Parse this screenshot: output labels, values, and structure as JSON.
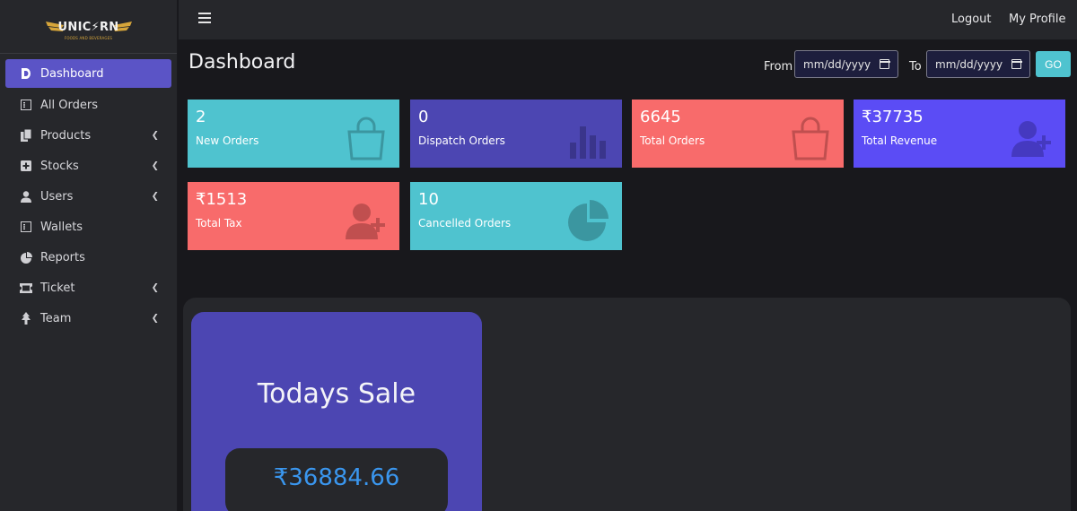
{
  "brand": {
    "logo_text": "UNIC⚡RN",
    "logo_sub": "FOODS AND BEVERAGES"
  },
  "sidebar": {
    "items": [
      {
        "label": "Dashboard",
        "icon": "dashboard-icon",
        "active": true,
        "has_submenu": false
      },
      {
        "label": "All Orders",
        "icon": "list-icon",
        "active": false,
        "has_submenu": false
      },
      {
        "label": "Products",
        "icon": "copy-icon",
        "active": false,
        "has_submenu": true
      },
      {
        "label": "Stocks",
        "icon": "plus-square-icon",
        "active": false,
        "has_submenu": true
      },
      {
        "label": "Users",
        "icon": "user-icon",
        "active": false,
        "has_submenu": true
      },
      {
        "label": "Wallets",
        "icon": "list-icon",
        "active": false,
        "has_submenu": false
      },
      {
        "label": "Reports",
        "icon": "pie-chart-icon",
        "active": false,
        "has_submenu": false
      },
      {
        "label": "Ticket",
        "icon": "ticket-icon",
        "active": false,
        "has_submenu": true
      },
      {
        "label": "Team",
        "icon": "tree-icon",
        "active": false,
        "has_submenu": true
      }
    ]
  },
  "topbar": {
    "logout": "Logout",
    "profile": "My Profile"
  },
  "main": {
    "title": "Dashboard",
    "from_label": "From",
    "to_label": "To",
    "from_placeholder": "mm/dd/yyyy",
    "to_placeholder": "mm/dd/yyyy",
    "go_label": "GO"
  },
  "cards": [
    {
      "value": "2",
      "label": "New Orders",
      "color": "#4fc3cf",
      "icon": "shopping-bag-icon"
    },
    {
      "value": "0",
      "label": "Dispatch Orders",
      "color": "#4c46b2",
      "icon": "bar-chart-icon"
    },
    {
      "value": "6645",
      "label": "Total Orders",
      "color": "#f86b6b",
      "icon": "shopping-bag-icon"
    },
    {
      "value": "₹37735",
      "label": "Total Revenue",
      "color": "#5b4cf5",
      "icon": "user-plus-icon"
    },
    {
      "value": "₹1513",
      "label": "Total Tax",
      "color": "#f86b6b",
      "icon": "user-plus-icon"
    },
    {
      "value": "10",
      "label": "Cancelled Orders",
      "color": "#4fc3cf",
      "icon": "pie-chart-icon"
    }
  ],
  "sale": {
    "title": "Todays Sale",
    "amount": "₹36884.66"
  }
}
